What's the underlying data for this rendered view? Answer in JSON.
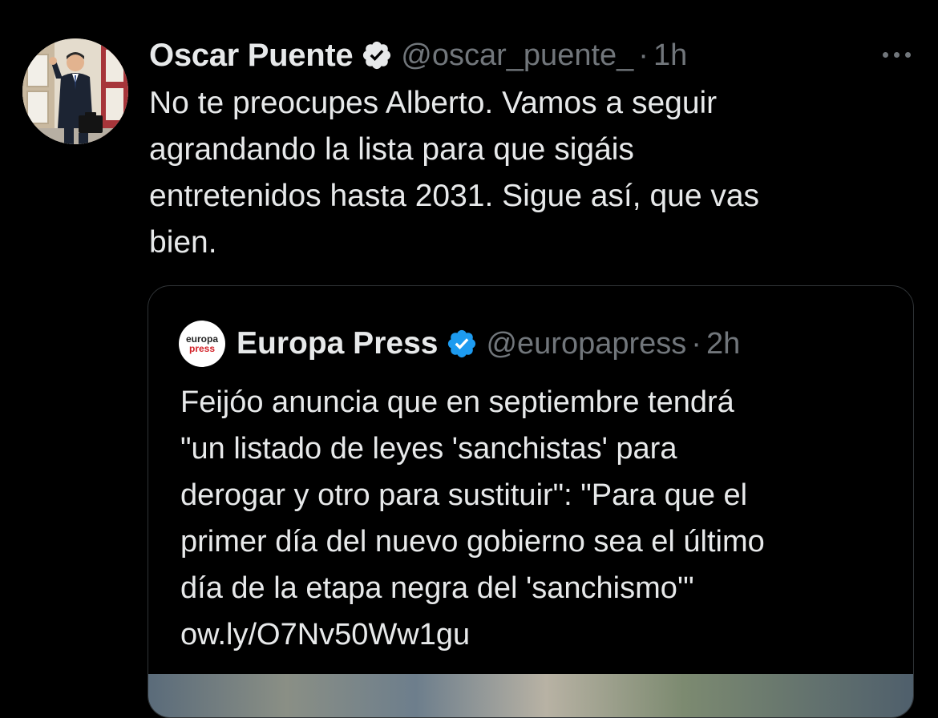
{
  "tweet": {
    "author_name": "Oscar Puente",
    "handle": "@oscar_puente_",
    "separator": "·",
    "time": "1h",
    "text": "No te preocupes Alberto. Vamos a seguir\nagrandando la lista para que sigáis\nentretenidos hasta 2031. Sigue así, que vas\nbien.",
    "avatar_icon": "profile-photo",
    "more_icon": "more-horizontal-icon"
  },
  "quoted": {
    "author_name": "Europa Press",
    "handle": "@europapress",
    "separator": "·",
    "time": "2h",
    "avatar_line1": "europa",
    "avatar_line2": "press",
    "text": "Feijóo anuncia que en septiembre tendrá\n\"un listado de leyes 'sanchistas' para\nderogar y otro para sustituir\": \"Para que el\nprimer día del nuevo gobierno sea el último\ndía de la etapa negra del 'sanchismo'\"\now.ly/O7Nv50Ww1gu"
  },
  "colors": {
    "background": "#000000",
    "text_primary": "#e7e9ea",
    "text_secondary": "#71767b",
    "verified_blue": "#1d9bf0",
    "border": "#2f3336",
    "europa_press_red": "#d21f26"
  }
}
